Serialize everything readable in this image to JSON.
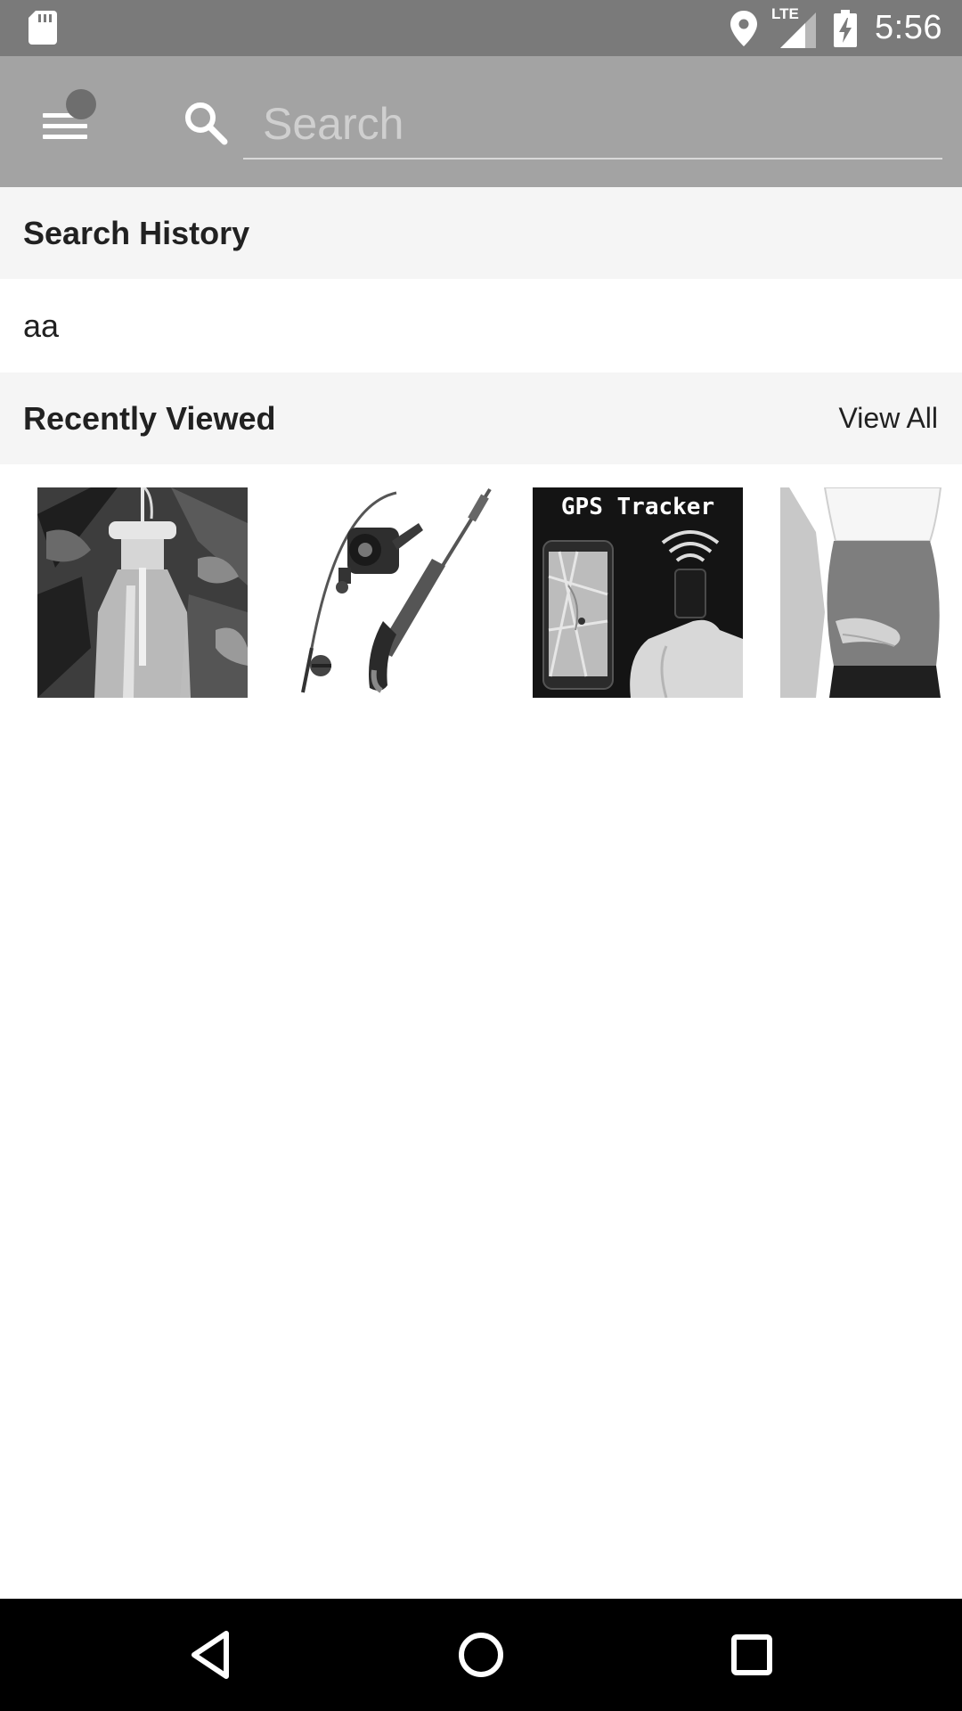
{
  "status_bar": {
    "time": "5:56",
    "network_label": "LTE",
    "icons": [
      "sd-card-icon",
      "location-icon",
      "signal-icon",
      "battery-charging-icon"
    ]
  },
  "toolbar": {
    "search_placeholder": "Search",
    "search_value": ""
  },
  "search_history": {
    "title": "Search History",
    "items": [
      "aa"
    ]
  },
  "recently_viewed": {
    "title": "Recently Viewed",
    "view_all_label": "View All",
    "products": [
      {
        "icon": "bottle-feeder-product-image"
      },
      {
        "icon": "fishing-rod-product-image"
      },
      {
        "icon": "gps-tracker-product-image",
        "caption": "GPS Tracker"
      },
      {
        "icon": "belly-band-product-image"
      }
    ]
  },
  "nav_bar": {
    "buttons": [
      "back-icon",
      "home-icon",
      "recents-icon"
    ]
  }
}
